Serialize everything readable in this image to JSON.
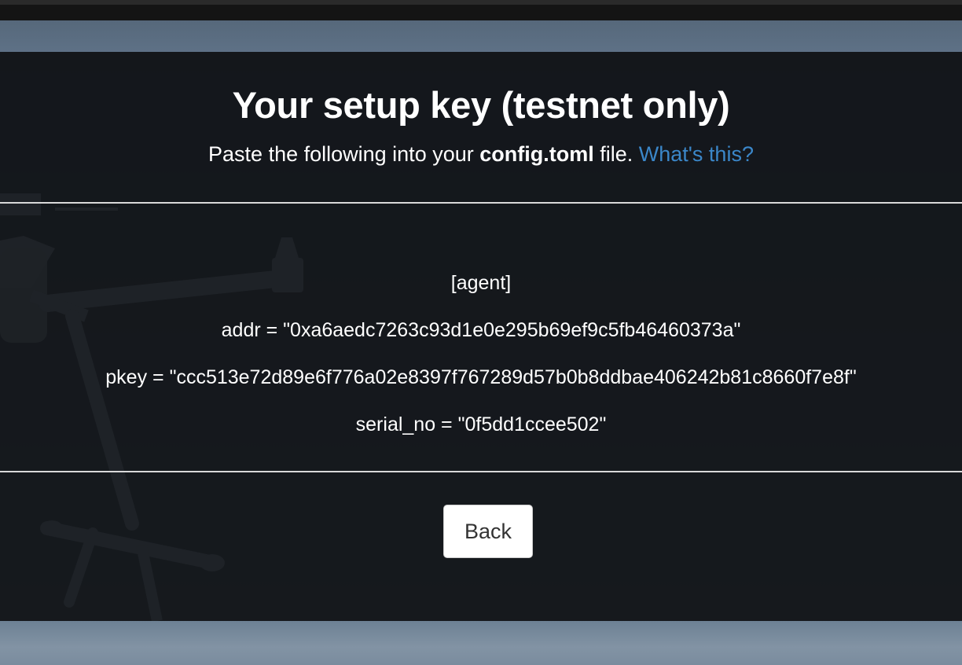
{
  "header": {
    "title": "Your setup key (testnet only)",
    "subtitle_prefix": "Paste the following into your ",
    "subtitle_filename": "config.toml",
    "subtitle_suffix": " file. ",
    "help_link": "What's this?"
  },
  "config": {
    "section": "[agent]",
    "addr_line": "addr = \"0xa6aedc7263c93d1e0e295b69ef9c5fb46460373a\"",
    "pkey_line": "pkey = \"ccc513e72d89e6f776a02e8397f767289d57b0b8ddbae406242b81c8660f7e8f\"",
    "serial_line": "serial_no = \"0f5dd1ccee502\""
  },
  "actions": {
    "back_label": "Back"
  },
  "colors": {
    "link": "#3b87c9",
    "panel": "#0e1013"
  }
}
